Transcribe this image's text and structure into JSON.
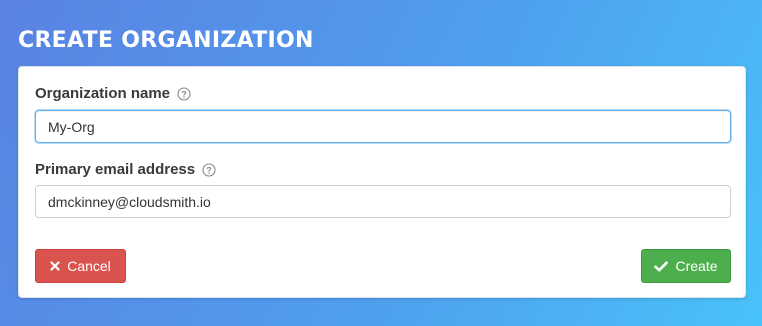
{
  "page": {
    "title": "CREATE ORGANIZATION"
  },
  "form": {
    "org_name": {
      "label": "Organization name",
      "value": "My-Org"
    },
    "email": {
      "label": "Primary email address",
      "value": "dmckinney@cloudsmith.io"
    }
  },
  "buttons": {
    "cancel_label": "Cancel",
    "create_label": "Create"
  },
  "icons": {
    "help": "question-circle-icon",
    "cancel": "times-icon",
    "create": "check-icon"
  },
  "colors": {
    "cancel": "#d9534f",
    "create": "#4cae4c",
    "focus": "#66afe9"
  }
}
